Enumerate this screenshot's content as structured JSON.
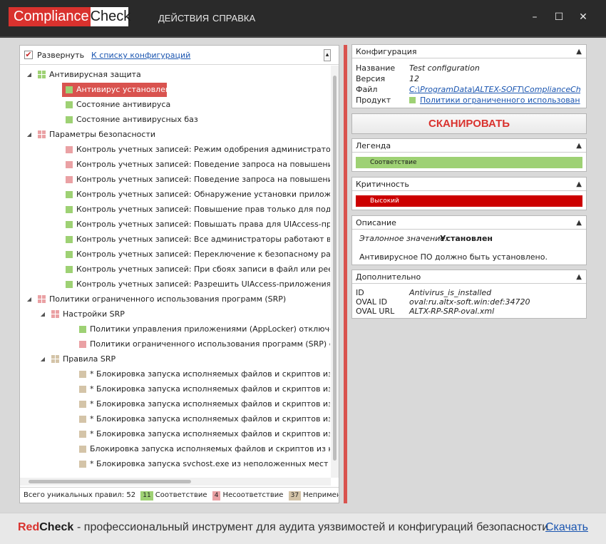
{
  "app": {
    "logo_part1": "Compliance",
    "logo_part2": "Check",
    "menu": [
      "ДЕЙСТВИЯ",
      "СПРАВКА"
    ],
    "window_buttons": [
      "–",
      "☐",
      "✕"
    ]
  },
  "left": {
    "expand_label": "Развернуть",
    "config_link": "К списку конфигураций",
    "tree": [
      {
        "level": 0,
        "expand": "◢",
        "icon": "group-green",
        "label": "Антивирусная защита"
      },
      {
        "level": 1,
        "status": "green",
        "label": "Антивирус установлен",
        "selected": true
      },
      {
        "level": 1,
        "status": "green",
        "label": "Состояние антивируса"
      },
      {
        "level": 1,
        "status": "green",
        "label": "Состояние антивирусных баз"
      },
      {
        "level": 0,
        "expand": "◢",
        "icon": "group-pink",
        "label": "Параметры безопасности"
      },
      {
        "level": 1,
        "status": "pink",
        "label": "Контроль учетных записей: Режим одобрения администратором для в"
      },
      {
        "level": 1,
        "status": "pink",
        "label": "Контроль учетных записей: Поведение запроса на повышение прав д"
      },
      {
        "level": 1,
        "status": "pink",
        "label": "Контроль учетных записей: Поведение запроса на повышение прав д"
      },
      {
        "level": 1,
        "status": "green",
        "label": "Контроль учетных записей: Обнаружение установки приложений и за"
      },
      {
        "level": 1,
        "status": "green",
        "label": "Контроль учетных записей: Повышение прав только для подписанны"
      },
      {
        "level": 1,
        "status": "green",
        "label": "Контроль учетных записей: Повышать права для UIAccess-приложени"
      },
      {
        "level": 1,
        "status": "green",
        "label": "Контроль учетных записей: Все администраторы работают в режиме"
      },
      {
        "level": 1,
        "status": "green",
        "label": "Контроль учетных записей: Переключение к безопасному рабочему с"
      },
      {
        "level": 1,
        "status": "green",
        "label": "Контроль учетных записей: При сбоях записи в файл или реестр вирт"
      },
      {
        "level": 1,
        "status": "green",
        "label": "Контроль учетных записей: Разрешить UIAccess-приложениям запращ"
      },
      {
        "level": 0,
        "expand": "◢",
        "icon": "group-pink",
        "label": "Политики ограниченного использования программ (SRP)"
      },
      {
        "level": 1,
        "expand": "◢",
        "icon": "group-pink",
        "label": "Настройки SRP"
      },
      {
        "level": 2,
        "status": "green",
        "label": "Политики управления приложениями (AppLocker) отключены или"
      },
      {
        "level": 2,
        "status": "pink",
        "label": "Политики ограниченного использования программ (SRP) создань"
      },
      {
        "level": 1,
        "expand": "◢",
        "icon": "group-tan",
        "label": "Правила SRP"
      },
      {
        "level": 2,
        "status": "tan",
        "label": "* Блокировка запуска исполняемых файлов и скриптов из %Progra"
      },
      {
        "level": 2,
        "status": "tan",
        "label": "* Блокировка запуска исполняемых файлов и скриптов из %AppDa"
      },
      {
        "level": 2,
        "status": "tan",
        "label": "* Блокировка запуска исполняемых файлов и скриптов из подката"
      },
      {
        "level": 2,
        "status": "tan",
        "label": "* Блокировка запуска исполняемых файлов и скриптов из каталог"
      },
      {
        "level": 2,
        "status": "tan",
        "label": "* Блокировка запуска исполняемых файлов и скриптов из Пуск\\Ав"
      },
      {
        "level": 2,
        "status": "tan",
        "label": "Блокировка запуска исполняемых файлов и скриптов из корзины"
      },
      {
        "level": 2,
        "status": "tan",
        "label": "* Блокировка запуска svchost.exe из неположенных мест"
      }
    ],
    "status": {
      "total_label": "Всего уникальных правил: 52",
      "compliant_count": "11",
      "compliant_label": "Соответствие",
      "noncompliant_count": "4",
      "noncompliant_label": "Несоответствие",
      "na_count": "37",
      "na_label": "Неприменимо"
    }
  },
  "right": {
    "config": {
      "title": "Конфигурация",
      "name_key": "Название",
      "name_val": "Test configuration",
      "version_key": "Версия",
      "version_val": "12",
      "file_key": "Файл",
      "file_val": "C:\\ProgramData\\ALTEX-SOFT\\ComplianceCheck\\",
      "product_key": "Продукт",
      "product_val": "Политики ограниченного использован"
    },
    "scan_button": "СКАНИРОВАТЬ",
    "legend": {
      "title": "Легенда",
      "bar": "Соответствие"
    },
    "criticality": {
      "title": "Критичность",
      "bar": "Высокий"
    },
    "description": {
      "title": "Описание",
      "ref_key": "Эталонное значение:",
      "ref_val": "Установлен",
      "text": "Антивирусное ПО должно быть установлено."
    },
    "extra": {
      "title": "Дополнительно",
      "id_key": "ID",
      "id_val": "Antivirus_is_installed",
      "oval_id_key": "OVAL ID",
      "oval_id_val": "oval:ru.altx-soft.win:def:34720",
      "oval_url_key": "OVAL URL",
      "oval_url_val": "ALTX-RP-SRP-oval.xml"
    }
  },
  "footer": {
    "brand1": "Red",
    "brand2": "Check",
    "tagline": "- профессиональный инструмент для аудита уязвимостей и конфигураций безопасности",
    "download": "Скачать"
  },
  "colors": {
    "accent_red": "#d9534f",
    "compliant_green": "#9ed174",
    "noncompliant_pink": "#eaa1a4",
    "na_tan": "#d4c4a8",
    "critical_red": "#cc0000"
  }
}
